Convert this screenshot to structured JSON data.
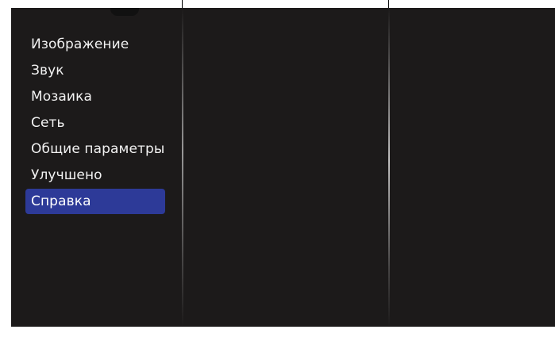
{
  "menu": {
    "items": [
      {
        "label": "Изображение"
      },
      {
        "label": "Звук"
      },
      {
        "label": "Мозаика"
      },
      {
        "label": "Сеть"
      },
      {
        "label": "Общие параметры"
      },
      {
        "label": "Улучшено"
      },
      {
        "label": "Справка"
      }
    ],
    "selected_index": 6
  },
  "colors": {
    "background": "#1c1a1a",
    "selection": "#2d3a98",
    "text": "#f2f2f2"
  }
}
